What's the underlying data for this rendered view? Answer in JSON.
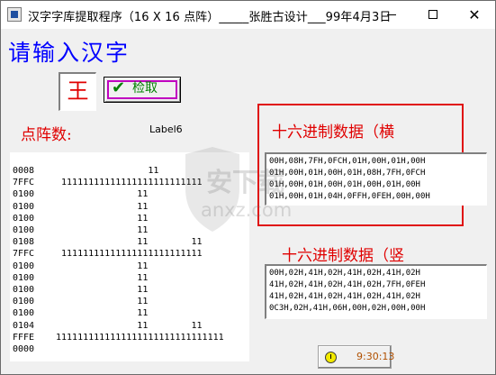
{
  "window": {
    "title": "汉字字库提取程序（16 X 16 点阵）_____张胜古设计___99年4月3日",
    "controls": {
      "minimize": "—",
      "maximize": "☐",
      "close": "✕"
    }
  },
  "main": {
    "prompt": "请输入汉字",
    "char_value": "王",
    "check_button": "检取",
    "dot_label": "点阵数:",
    "label6": "Label6"
  },
  "dot_matrix": [
    {
      "hex": "0008",
      "bits": "                 11"
    },
    {
      "hex": "7FFC",
      "bits": " 11111111111111111111111111"
    },
    {
      "hex": "0100",
      "bits": "               11"
    },
    {
      "hex": "0100",
      "bits": "               11"
    },
    {
      "hex": "0100",
      "bits": "               11"
    },
    {
      "hex": "0100",
      "bits": "               11"
    },
    {
      "hex": "0108",
      "bits": "               11        11"
    },
    {
      "hex": "7FFC",
      "bits": " 11111111111111111111111111"
    },
    {
      "hex": "0100",
      "bits": "               11"
    },
    {
      "hex": "0100",
      "bits": "               11"
    },
    {
      "hex": "0100",
      "bits": "               11"
    },
    {
      "hex": "0100",
      "bits": "               11"
    },
    {
      "hex": "0100",
      "bits": "               11"
    },
    {
      "hex": "0104",
      "bits": "               11        11"
    },
    {
      "hex": "FFFE",
      "bits": "1111111111111111111111111111111"
    },
    {
      "hex": "0000",
      "bits": ""
    }
  ],
  "hex_horizontal": {
    "label": "十六进制数据（横",
    "lines": [
      "00H,08H,7FH,0FCH,01H,00H,01H,00H",
      "01H,00H,01H,00H,01H,08H,7FH,0FCH",
      "01H,00H,01H,00H,01H,00H,01H,00H",
      "01H,00H,01H,04H,0FFH,0FEH,00H,00H"
    ]
  },
  "hex_vertical": {
    "label": "十六进制数据（竖",
    "lines": [
      "00H,02H,41H,02H,41H,02H,41H,02H",
      "41H,02H,41H,02H,41H,02H,7FH,0FEH",
      "41H,02H,41H,02H,41H,02H,41H,02H",
      "0C3H,02H,41H,06H,00H,02H,00H,00H"
    ]
  },
  "clock": {
    "time": "9:30:13"
  },
  "watermark": {
    "text": "安下载",
    "sub": "anxz.com"
  },
  "colors": {
    "prompt_blue": "#0000ff",
    "label_red": "#e00000",
    "frame_red": "#e01010",
    "check_green": "#008000",
    "focus_magenta": "#c000c0",
    "clock_text": "#b05000"
  }
}
